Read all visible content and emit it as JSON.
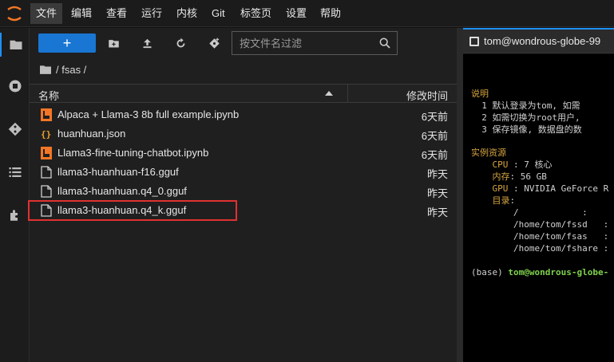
{
  "menu": {
    "items": [
      "文件",
      "编辑",
      "查看",
      "运行",
      "内核",
      "Git",
      "标签页",
      "设置",
      "帮助"
    ],
    "active_index": 0
  },
  "activity_bar": {
    "icons": [
      "folder-icon",
      "running-icon",
      "git-icon",
      "toc-icon",
      "extension-icon"
    ]
  },
  "toolbar": {
    "new_label": "+",
    "search_placeholder": "按文件名过滤"
  },
  "breadcrumb": {
    "text": "/ fsas /"
  },
  "listing": {
    "header_name": "名称",
    "header_modified": "修改时间",
    "files": [
      {
        "name": "Alpaca + Llama-3 8b full example.ipynb",
        "modified": "6天前",
        "icon": "notebook-icon"
      },
      {
        "name": "huanhuan.json",
        "modified": "6天前",
        "icon": "json-icon"
      },
      {
        "name": "Llama3-fine-tuning-chatbot.ipynb",
        "modified": "6天前",
        "icon": "notebook-icon"
      },
      {
        "name": "llama3-huanhuan-f16.gguf",
        "modified": "昨天",
        "icon": "file-icon"
      },
      {
        "name": "llama3-huanhuan.q4_0.gguf",
        "modified": "昨天",
        "icon": "file-icon"
      },
      {
        "name": "llama3-huanhuan.q4_k.gguf",
        "modified": "昨天",
        "icon": "file-icon",
        "highlighted": true
      }
    ]
  },
  "terminal": {
    "tab_label": "tom@wondrous-globe-99",
    "lines": {
      "l1": "说明",
      "l2": "  1 默认登录为tom, 如需",
      "l3": "  2 如需切换为root用户,",
      "l4": "  3 保存镜像, 数据盘的数",
      "l5": "实例资源",
      "l6_key": "    CPU",
      "l6_val": " : 7 核心",
      "l7_key": "    内存",
      "l7_val": ": 56 GB",
      "l8_key": "    GPU",
      "l8_val": " : NVIDIA GeForce R",
      "l9_key": "    目录",
      "l9_val": ":",
      "l10": "        /            :",
      "l11": "        /home/tom/fssd   :",
      "l12": "        /home/tom/fsas   :",
      "l13": "        /home/tom/fshare :",
      "l14_prefix": "(base) ",
      "l14_user": "tom@wondrous-globe-"
    }
  },
  "colors": {
    "accent": "#1976d2",
    "highlight_border": "#e03131",
    "terminal_yellow": "#d7a640",
    "terminal_green": "#7fd14d"
  }
}
